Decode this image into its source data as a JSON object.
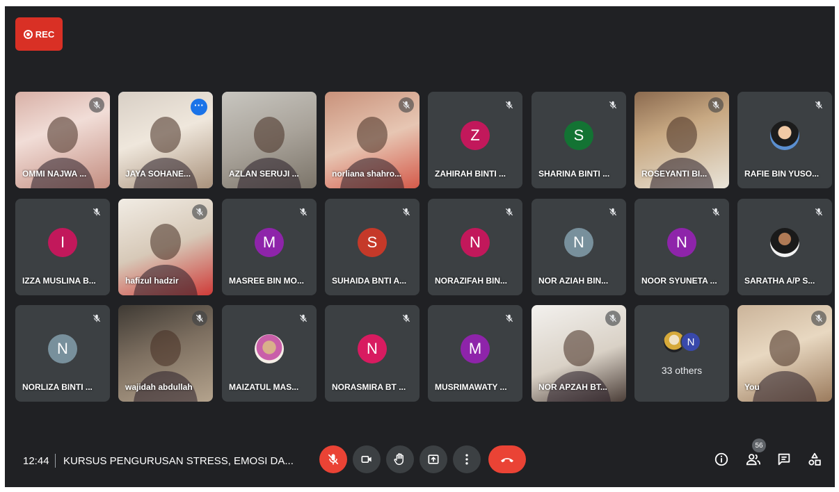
{
  "recording": {
    "label": "REC"
  },
  "participants": [
    {
      "name": "OMMI NAJWA ...",
      "muted": true,
      "video": true
    },
    {
      "name": "JAYA SOHANE...",
      "muted": false,
      "video": true,
      "active": true
    },
    {
      "name": "AZLAN SERUJI ...",
      "muted": false,
      "video": true
    },
    {
      "name": "norliana shahro...",
      "muted": true,
      "video": true
    },
    {
      "name": "ZAHIRAH BINTI ...",
      "muted": true,
      "initial": "Z",
      "color": "#c2185b"
    },
    {
      "name": "SHARINA BINTI ...",
      "muted": true,
      "initial": "S",
      "color": "#137333"
    },
    {
      "name": "ROSEYANTI BI...",
      "muted": true,
      "video": true
    },
    {
      "name": "RAFIE BIN YUSO...",
      "muted": true,
      "photo": true
    },
    {
      "name": "IZZA MUSLINA B...",
      "muted": true,
      "initial": "I",
      "color": "#c2185b"
    },
    {
      "name": "hafizul hadzir",
      "muted": true,
      "video": true
    },
    {
      "name": "MASREE BIN MO...",
      "muted": true,
      "initial": "M",
      "color": "#8e24aa"
    },
    {
      "name": "SUHAIDA BNTI A...",
      "muted": true,
      "initial": "S",
      "color": "#c53929"
    },
    {
      "name": "NORAZIFAH BIN...",
      "muted": true,
      "initial": "N",
      "color": "#c2185b"
    },
    {
      "name": "NOR AZIAH BIN...",
      "muted": true,
      "initial": "N",
      "color": "#78909c"
    },
    {
      "name": "NOOR SYUNETA ...",
      "muted": true,
      "initial": "N",
      "color": "#8e24aa"
    },
    {
      "name": "SARATHA A/P S...",
      "muted": true,
      "photo": true
    },
    {
      "name": "NORLIZA BINTI ...",
      "muted": true,
      "initial": "N",
      "color": "#78909c"
    },
    {
      "name": "wajidah abdullah",
      "muted": true,
      "video": true
    },
    {
      "name": "MAIZATUL MAS...",
      "muted": true,
      "photo": true
    },
    {
      "name": "NORASMIRA BT ...",
      "muted": true,
      "initial": "N",
      "color": "#d81b60"
    },
    {
      "name": "MUSRIMAWATY ...",
      "muted": true,
      "initial": "M",
      "color": "#8e24aa"
    },
    {
      "name": "NOR APZAH BT...",
      "muted": true,
      "video": true
    },
    {
      "name": "",
      "others": true
    },
    {
      "name": "You",
      "muted": true,
      "video": true
    }
  ],
  "others": {
    "label": "33 others",
    "initial": "N",
    "color": "#3949ab"
  },
  "bottom": {
    "time": "12:44",
    "meeting_title": "KURSUS PENGURUSAN STRESS, EMOSI DA...",
    "participant_count": "56"
  },
  "colors": {
    "background": "#202124",
    "tile": "#3c4043",
    "red": "#ea4335",
    "rec": "#d93025",
    "active_border": "#8ab4f8"
  }
}
